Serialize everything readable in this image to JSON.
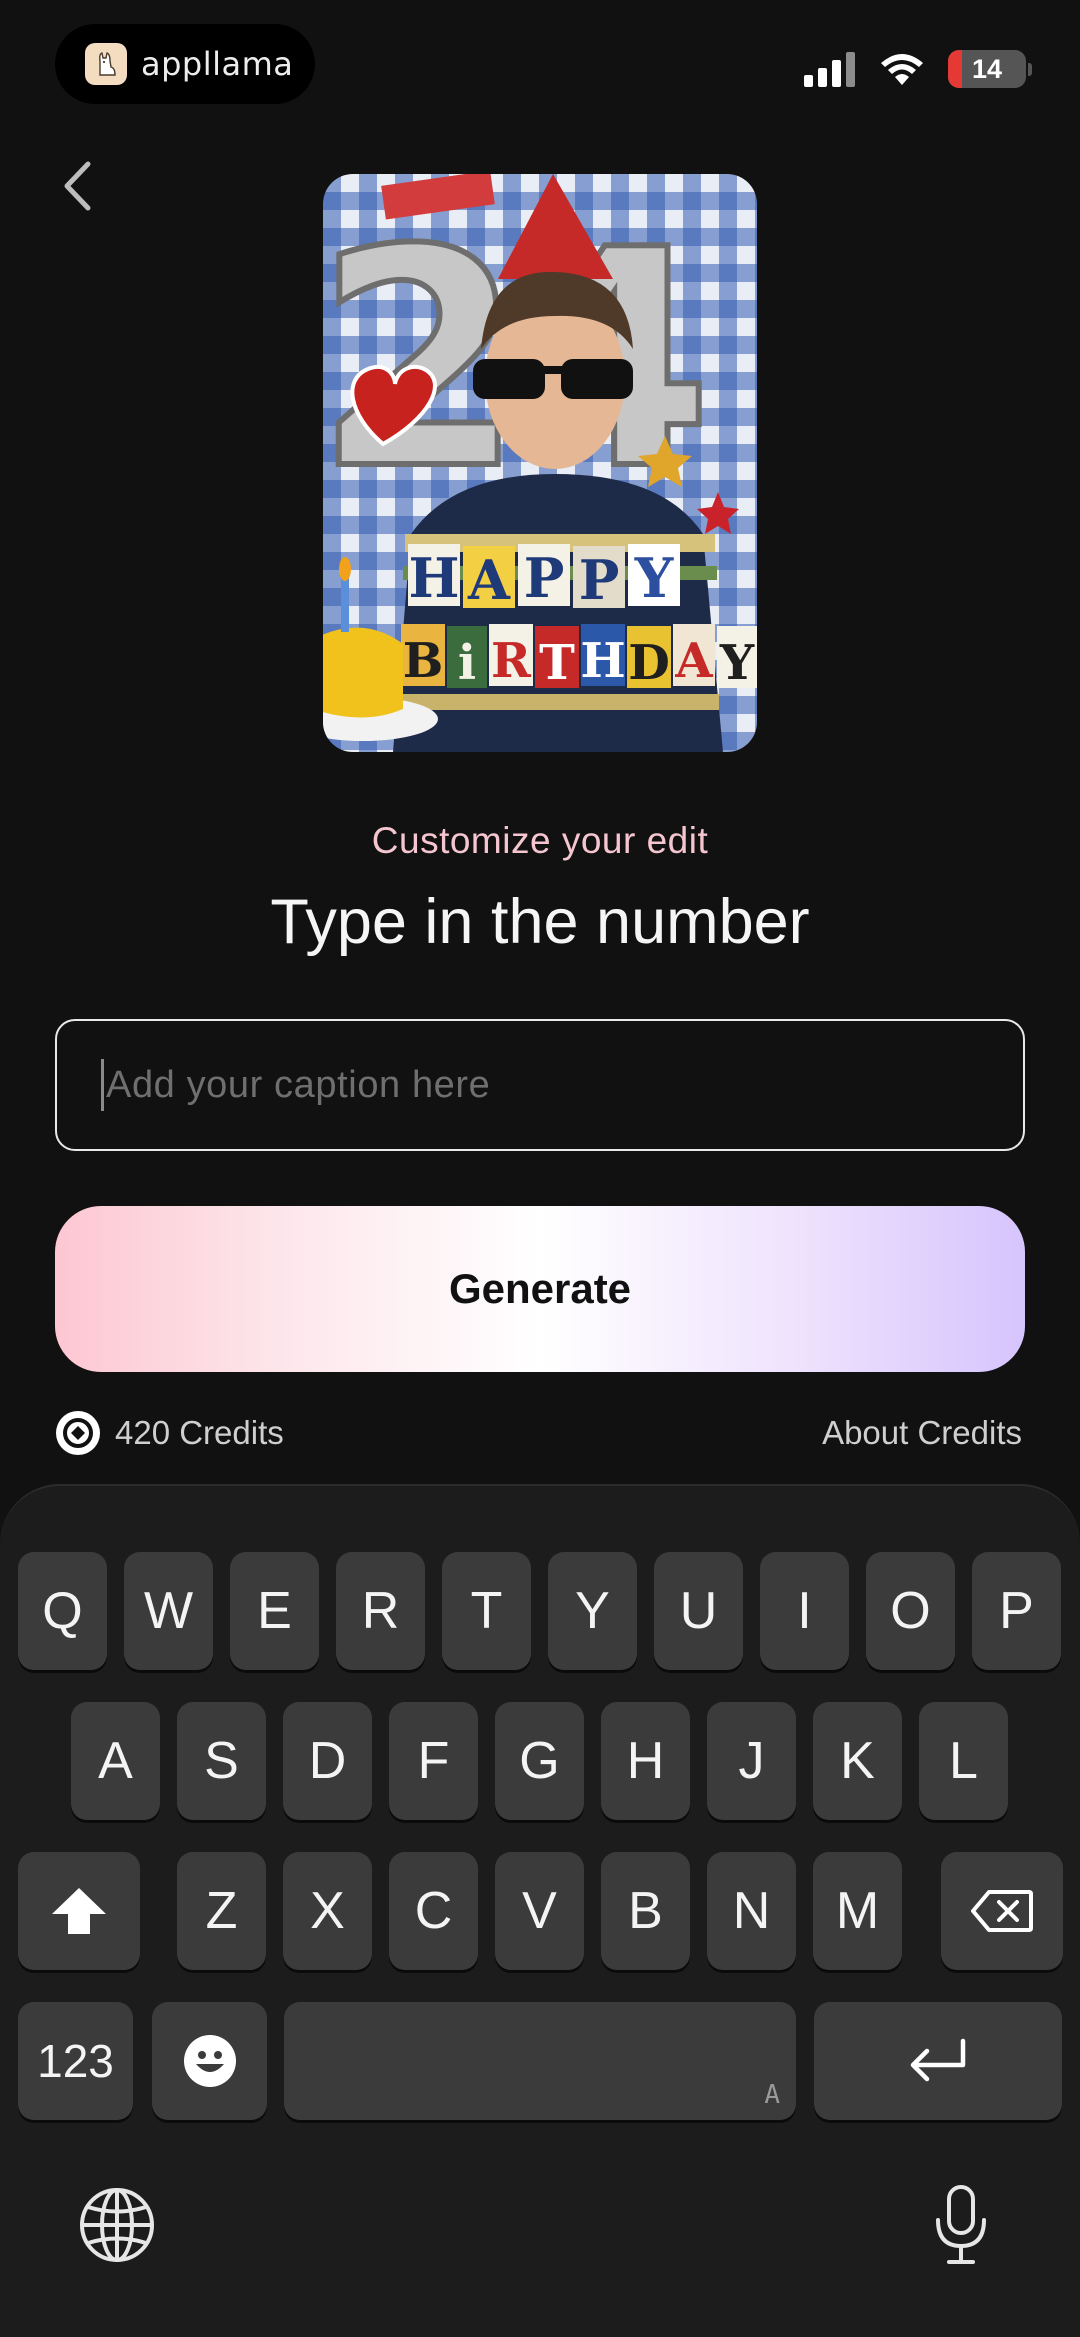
{
  "status_bar": {
    "app_pill_label": "appllama",
    "battery_level": "14"
  },
  "header": {
    "back_icon": "chevron-left-icon"
  },
  "preview": {
    "number_text": "24",
    "happy_letters": [
      "H",
      "A",
      "P",
      "P",
      "Y"
    ],
    "birthday_letters": [
      "B",
      "i",
      "R",
      "T",
      "H",
      "D",
      "A",
      "Y"
    ]
  },
  "main": {
    "subtitle": "Customize your edit",
    "title": "Type in the number",
    "caption_placeholder": "Add your caption here",
    "caption_value": "",
    "generate_label": "Generate",
    "credits_label": "420 Credits",
    "about_credits_label": "About Credits"
  },
  "keyboard": {
    "row1": [
      "Q",
      "W",
      "E",
      "R",
      "T",
      "Y",
      "U",
      "I",
      "O",
      "P"
    ],
    "row2": [
      "A",
      "S",
      "D",
      "F",
      "G",
      "H",
      "J",
      "K",
      "L"
    ],
    "row3": [
      "Z",
      "X",
      "C",
      "V",
      "B",
      "N",
      "M"
    ],
    "numbers_label": "123",
    "space_hint": "A"
  },
  "colors": {
    "accent_pink": "#f6c6d0",
    "gradient_start": "#fdc7d2",
    "gradient_end": "#d6c4fd",
    "background": "#111111"
  }
}
